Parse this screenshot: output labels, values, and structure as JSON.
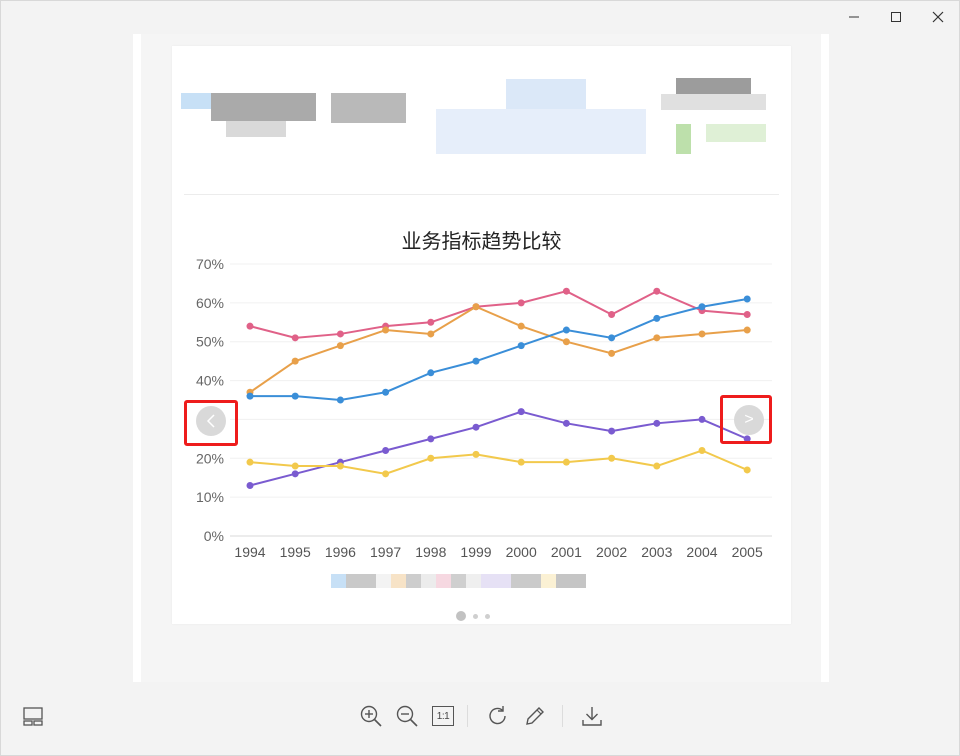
{
  "window_controls": {
    "minimize": "minimize-icon",
    "maximize": "maximize-icon",
    "close": "close-icon"
  },
  "chart_data": {
    "type": "line",
    "title": "业务指标趋势比较",
    "categories": [
      "1994",
      "1995",
      "1996",
      "1997",
      "1998",
      "1999",
      "2000",
      "2001",
      "2002",
      "2003",
      "2004",
      "2005"
    ],
    "y_ticks": [
      "0%",
      "10%",
      "20%",
      "30%",
      "40%",
      "50%",
      "60%",
      "70%"
    ],
    "ylim": [
      0,
      70
    ],
    "grid": true,
    "series": [
      {
        "color": "#e06188",
        "values": [
          54,
          51,
          52,
          54,
          55,
          59,
          60,
          63,
          57,
          63,
          58,
          57
        ]
      },
      {
        "color": "#e8a04a",
        "values": [
          37,
          45,
          49,
          53,
          52,
          59,
          54,
          50,
          47,
          51,
          52,
          53
        ]
      },
      {
        "color": "#3a8ed8",
        "values": [
          36,
          36,
          35,
          37,
          42,
          45,
          49,
          53,
          51,
          56,
          59,
          61
        ]
      },
      {
        "color": "#7a5bd0",
        "values": [
          13,
          16,
          19,
          22,
          25,
          28,
          32,
          29,
          27,
          29,
          30,
          25
        ]
      },
      {
        "color": "#f2c94c",
        "values": [
          19,
          18,
          18,
          16,
          20,
          21,
          19,
          19,
          20,
          18,
          22,
          17
        ]
      }
    ]
  },
  "nav": {
    "prev_icon": "chevron-left-icon",
    "next_icon": "chevron-right-icon",
    "next_glyph": ">"
  },
  "toolbar": {
    "thumbnails": "thumbnail-icon",
    "zoom_in": "zoom-in-icon",
    "zoom_out": "zoom-out-icon",
    "actual_size_label": "1:1",
    "rotate": "rotate-icon",
    "edit": "pencil-icon",
    "download": "download-icon"
  },
  "colors": {
    "highlight": "#ee1c1c",
    "background": "#f3f3f3"
  }
}
